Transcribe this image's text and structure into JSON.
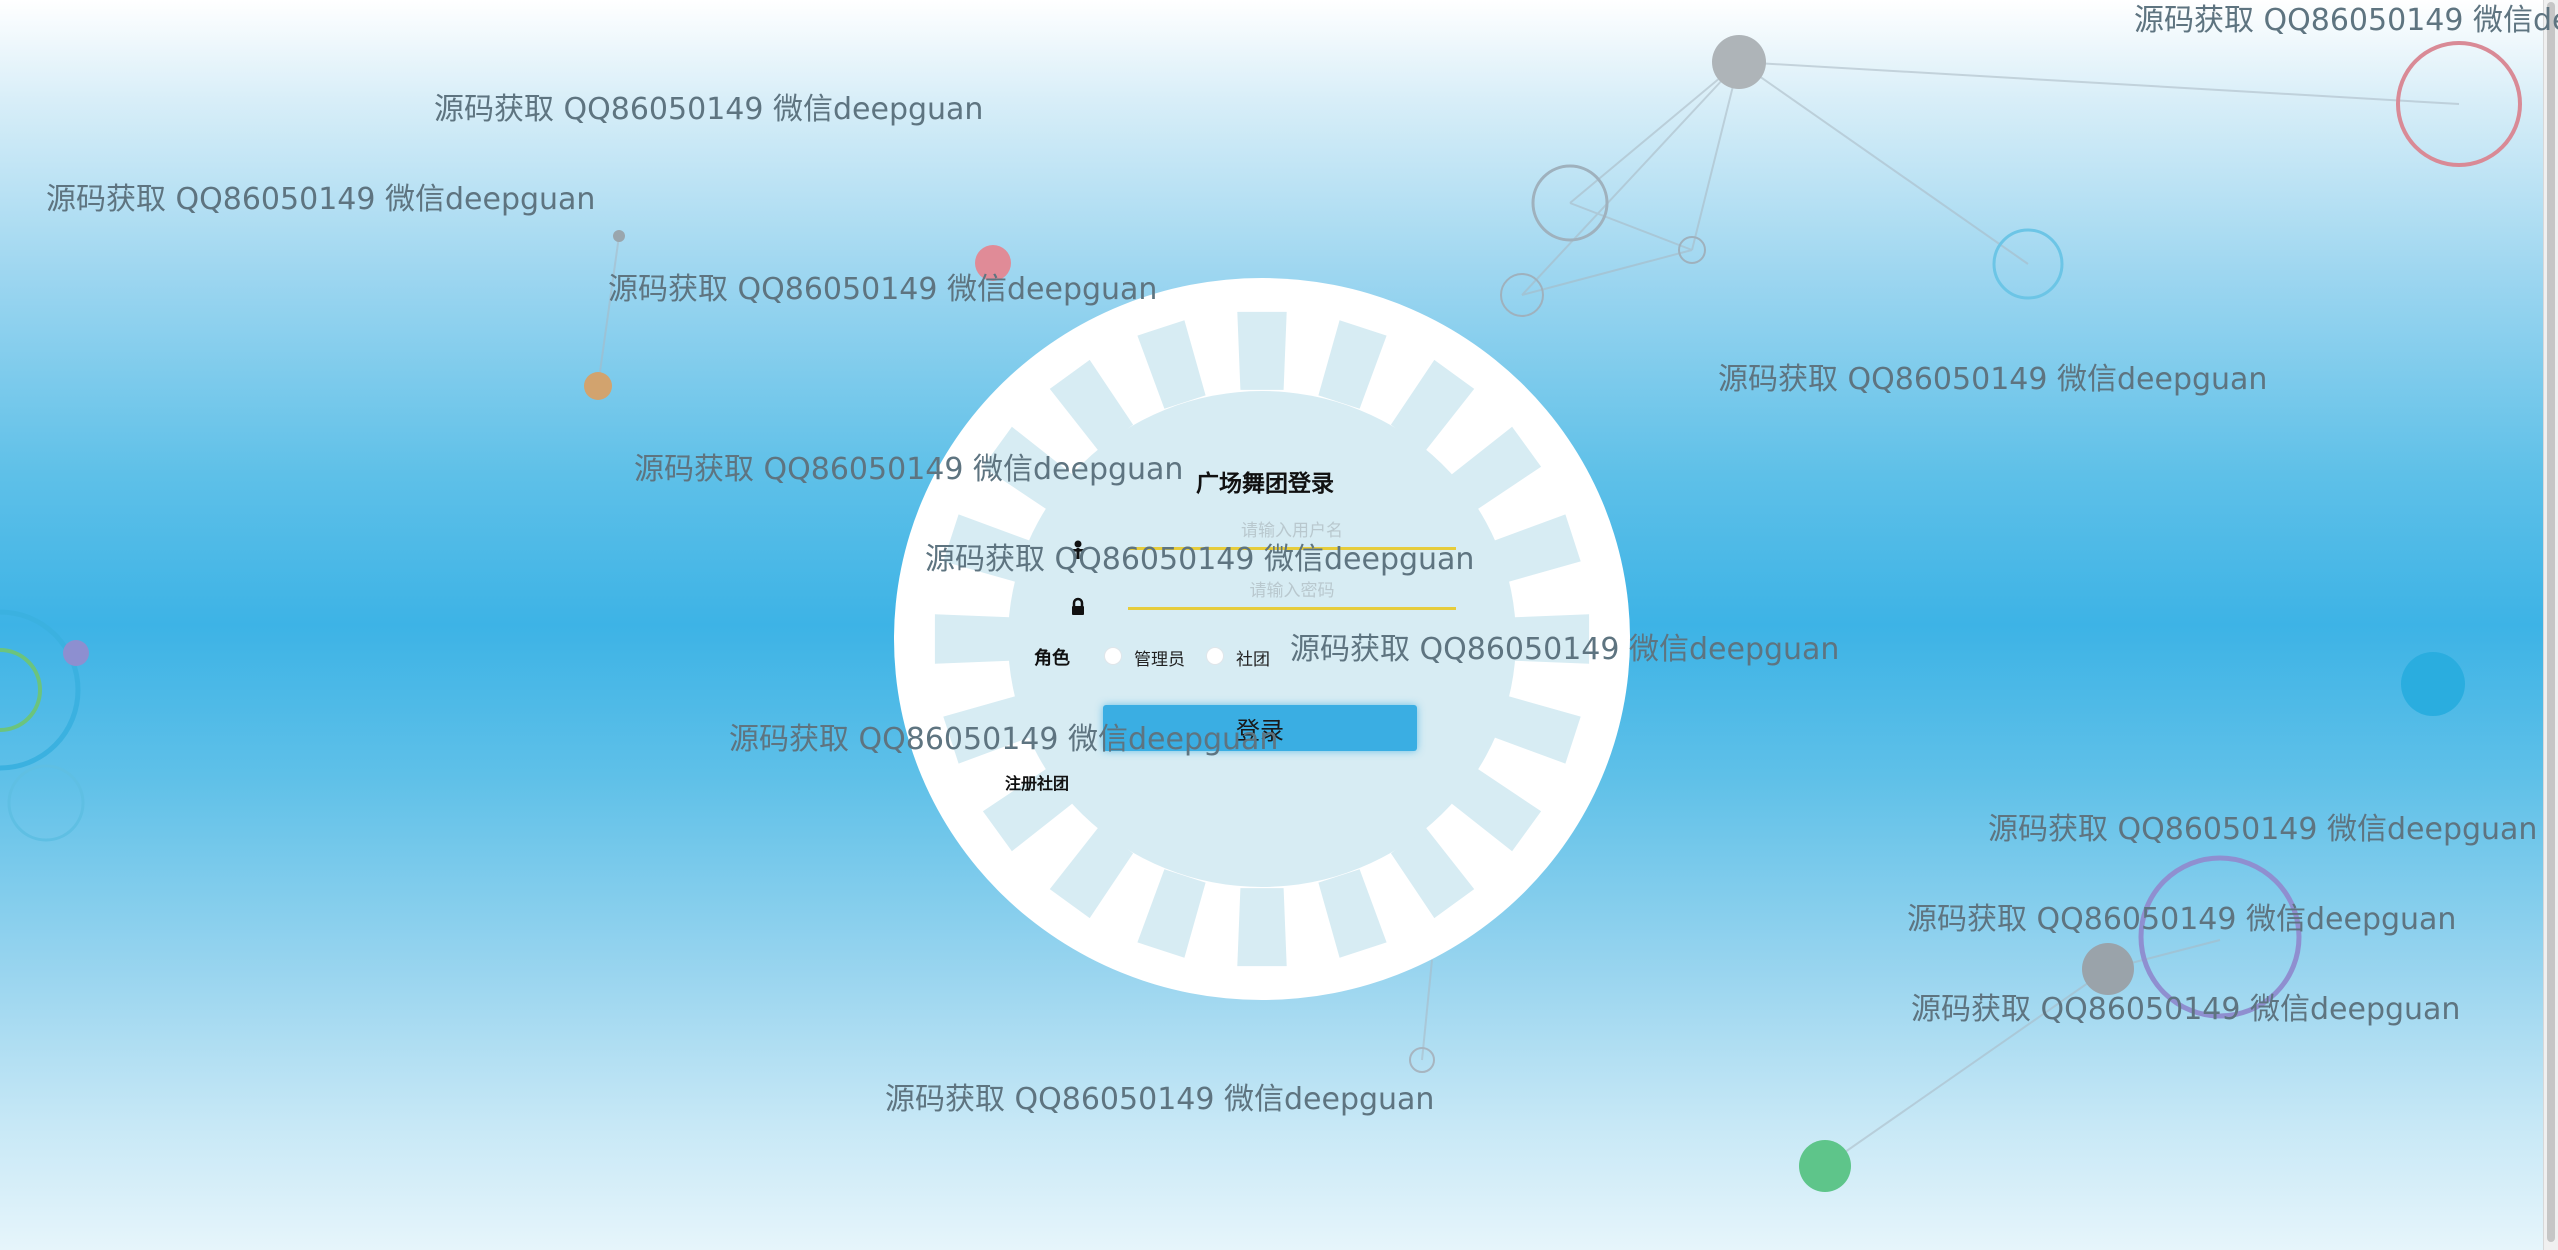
{
  "login": {
    "title": "广场舞团登录",
    "username_placeholder": "请输入用户名",
    "password_placeholder": "请输入密码",
    "role_label": "角色",
    "roles": [
      {
        "label": "管理员",
        "selected": false
      },
      {
        "label": "社团",
        "selected": false
      }
    ],
    "submit_label": "登录",
    "register_label": "注册社团",
    "icons": {
      "username": "user-icon",
      "password": "lock-icon"
    }
  },
  "watermark_text": "源码获取 QQ86050149 微信deepguan",
  "watermark_truncated_text": "源码获取 QQ86050149 微信de",
  "colors": {
    "accent": "#3aaee3",
    "input_underline": "#e6cc3b",
    "watermark": "#5e7480"
  }
}
